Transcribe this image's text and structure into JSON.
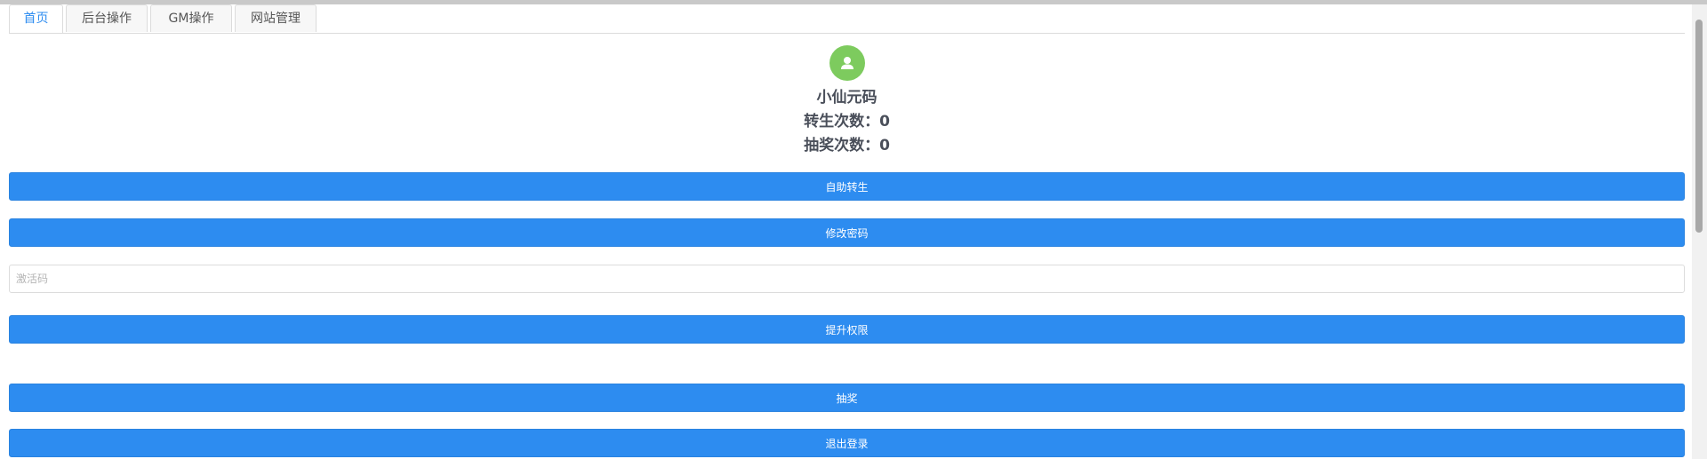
{
  "tabs": [
    {
      "label": "首页",
      "active": true
    },
    {
      "label": "后台操作",
      "active": false
    },
    {
      "label": "GM操作",
      "active": false
    },
    {
      "label": "网站管理",
      "active": false
    }
  ],
  "profile": {
    "avatar_icon": "user-icon",
    "avatar_color": "#7dcb5e",
    "username": "小仙元码",
    "rebirth_line": "转生次数：0",
    "lottery_line": "抽奖次数：0"
  },
  "actions": {
    "self_rebirth_label": "自助转生",
    "change_password_label": "修改密码",
    "activation_code_placeholder": "激活码",
    "activation_code_value": "",
    "upgrade_permission_label": "提升权限",
    "lottery_label": "抽奖",
    "logout_label": "退出登录"
  },
  "colors": {
    "primary": "#2d8cf0",
    "active_tab_text": "#2d8cf0"
  }
}
